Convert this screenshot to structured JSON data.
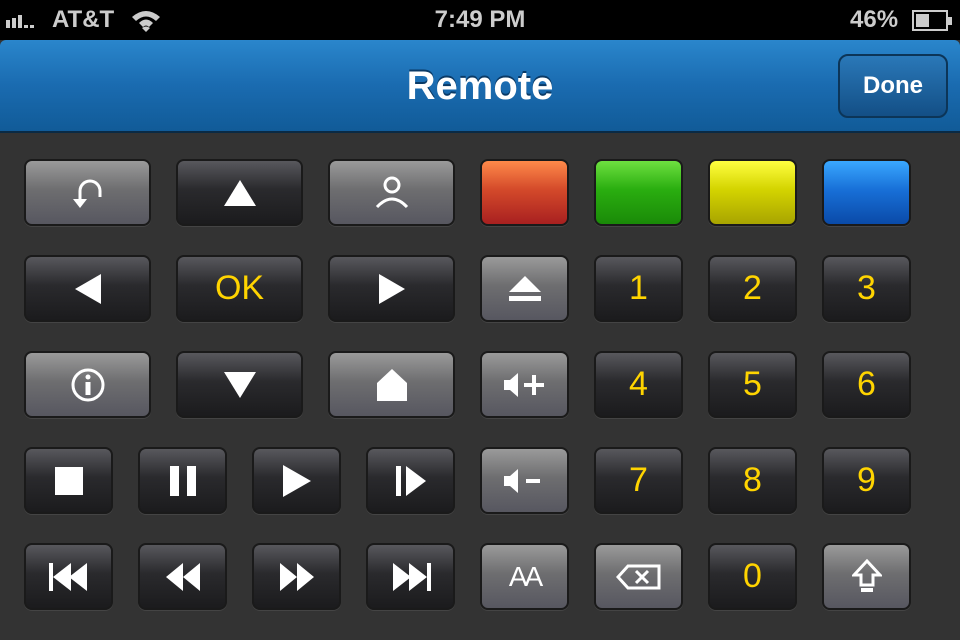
{
  "status": {
    "carrier": "AT&T",
    "time": "7:49 PM",
    "battery": "46%"
  },
  "nav": {
    "title": "Remote",
    "done": "Done"
  },
  "keys": {
    "ok": "OK",
    "n1": "1",
    "n2": "2",
    "n3": "3",
    "n4": "4",
    "n5": "5",
    "n6": "6",
    "n7": "7",
    "n8": "8",
    "n9": "9",
    "n0": "0",
    "text_size": "AA"
  },
  "colors": {
    "red": "#d44a2a",
    "green": "#2aae10",
    "yellow": "#d4d400",
    "blue": "#1870d8",
    "accent": "#ffd400"
  }
}
